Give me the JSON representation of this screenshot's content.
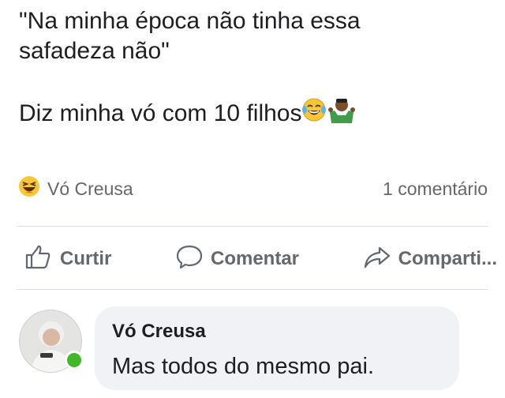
{
  "post": {
    "text_line1": "\"Na minha época não tinha essa",
    "text_line1b": "safadeza não\"",
    "text_line2": "Diz minha vó com 10 filhos",
    "emojis": [
      "laughing-crying-face-icon",
      "shrugging-man-icon"
    ]
  },
  "reactions": {
    "reaction_icon": "laughing-face-icon",
    "reactor_name": "Vó Creusa",
    "comment_count": "1 comentário"
  },
  "actions": {
    "like_label": "Curtir",
    "comment_label": "Comentar",
    "share_label": "Comparti..."
  },
  "comment": {
    "author": "Vó Creusa",
    "text": "Mas todos do mesmo pai."
  },
  "colors": {
    "text": "#1c1e21",
    "secondary": "#65676b",
    "bubble": "#f0f2f5",
    "online": "#42b72a"
  }
}
